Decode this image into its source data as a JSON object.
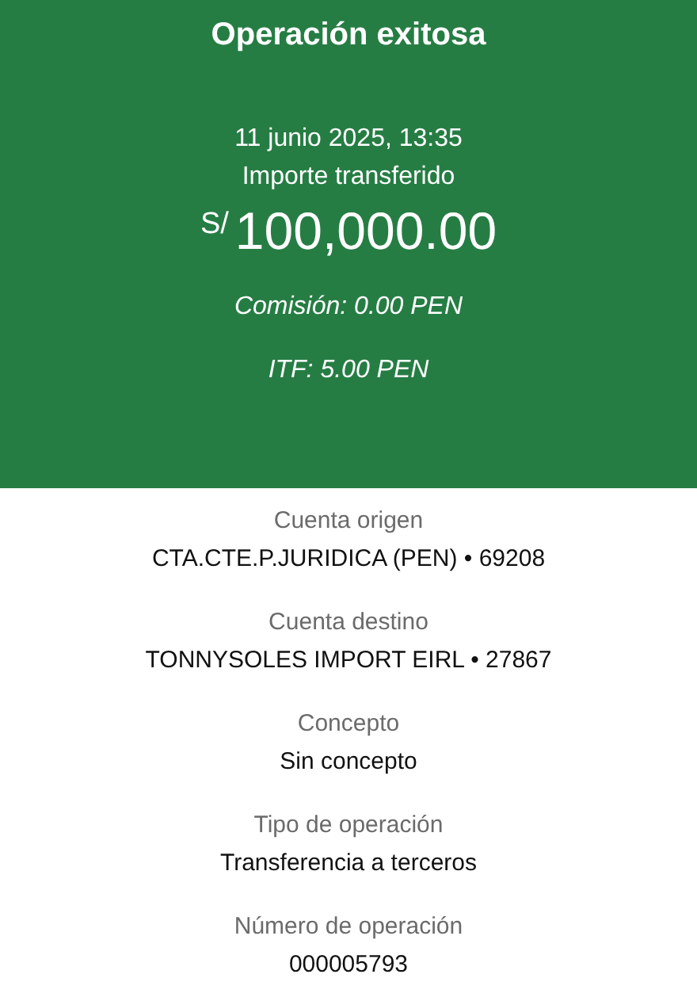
{
  "header": {
    "title": "Operación exitosa",
    "date": "11 junio 2025, 13:35",
    "amount_label": "Importe transferido",
    "currency": "S/",
    "amount": "100,000.00",
    "fees": [
      "Comisión: 0.00 PEN",
      "ITF: 5.00 PEN"
    ]
  },
  "details": [
    {
      "label": "Cuenta origen",
      "value": "CTA.CTE.P.JURIDICA (PEN) • 69208"
    },
    {
      "label": "Cuenta destino",
      "value": "TONNYSOLES IMPORT EIRL • 27867"
    },
    {
      "label": "Concepto",
      "value": "Sin concepto"
    },
    {
      "label": "Tipo de operación",
      "value": "Transferencia a terceros"
    },
    {
      "label": "Número de operación",
      "value": "000005793"
    }
  ]
}
